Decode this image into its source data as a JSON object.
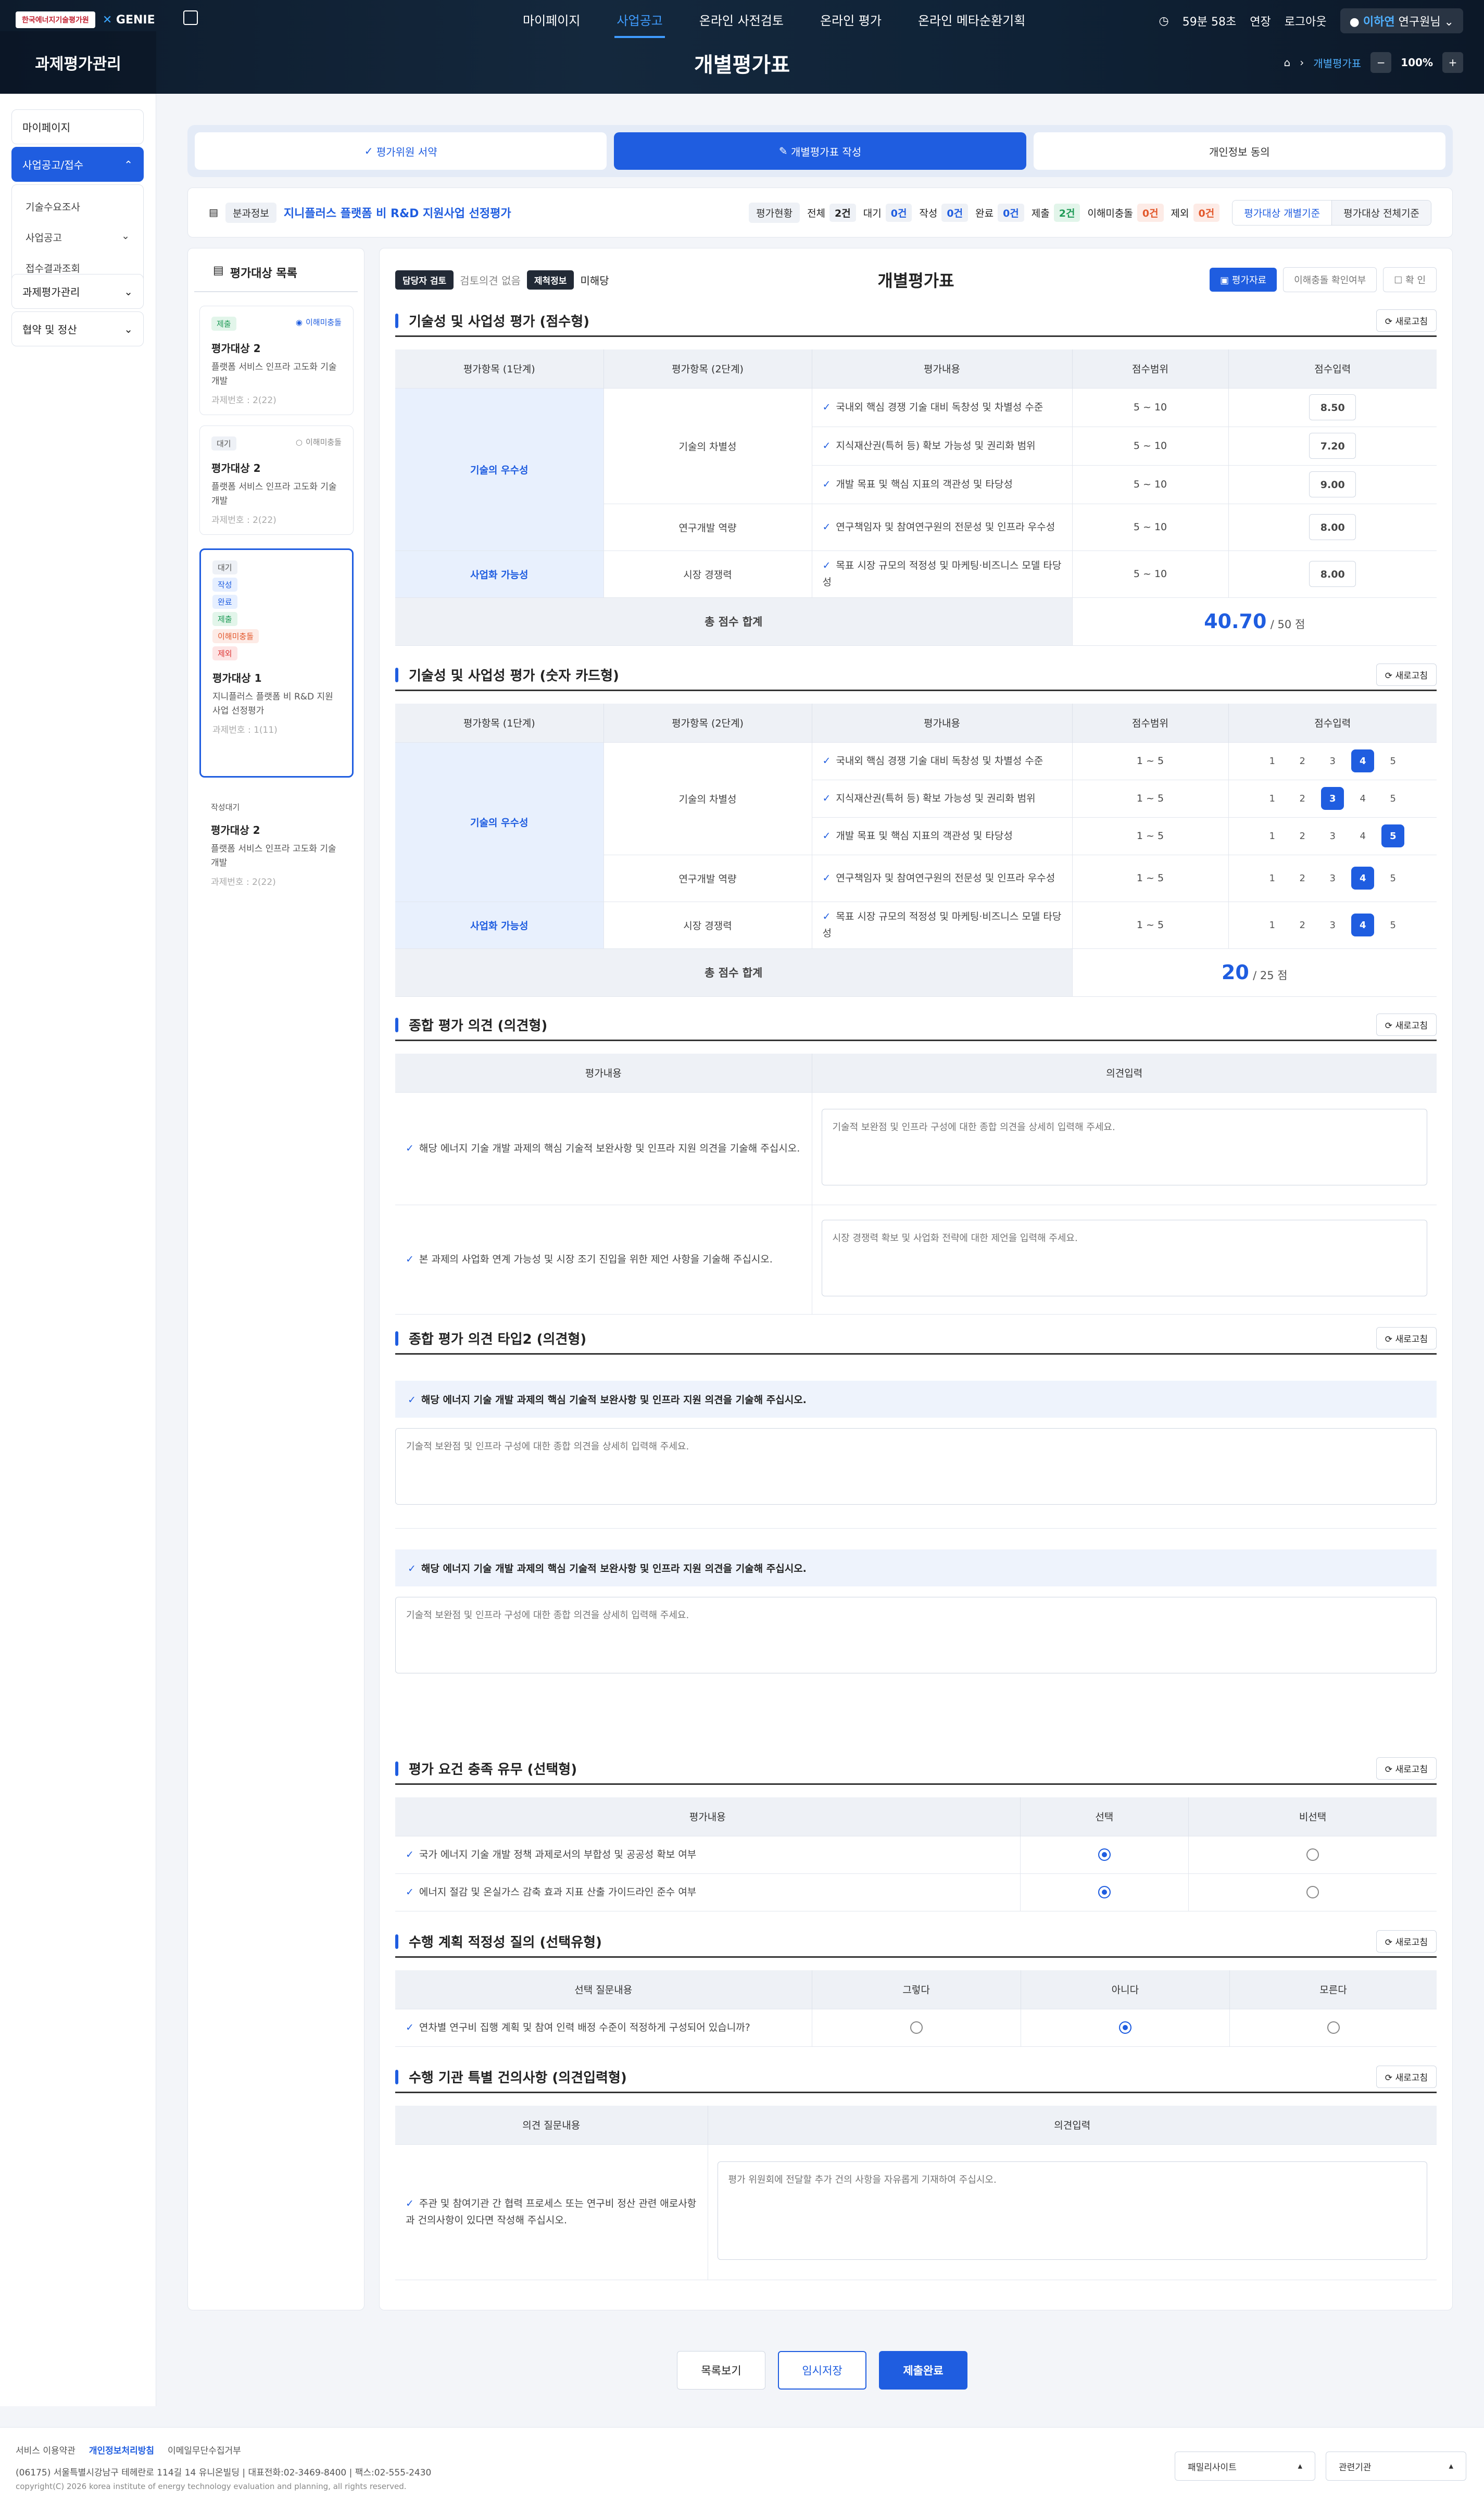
{
  "header": {
    "logo_left": "한국에너지기술평가원",
    "logo_right": "GENIE",
    "menu": [
      "마이페이지",
      "사업공고",
      "온라인 사전검토",
      "온라인 평가",
      "온라인 메타순환기획"
    ],
    "timer": "59분 58초",
    "extend": "연장",
    "logout": "로그아웃",
    "user_name": "이하연",
    "user_role": "연구원님",
    "section_title": "과제평가관리",
    "page_title": "개별평가표",
    "breadcrumb_current": "개별평가표",
    "zoom": "100%"
  },
  "sidebar": {
    "items": [
      "마이페이지",
      "사업공고/접수",
      "과제평가관리",
      "협약 및 정산"
    ],
    "sub_items": [
      "기술수요조사",
      "사업공고",
      "접수결과조회"
    ]
  },
  "steps": [
    "평가위원 서약",
    "개별평가표 작성",
    "개인정보 동의"
  ],
  "info": {
    "label": "분과정보",
    "project": "지니플러스 플랫폼 비 R&D 지원사업 선정평가",
    "status_label": "평가현황",
    "stats": [
      {
        "label": "전체",
        "value": "2건"
      },
      {
        "label": "대기",
        "value": "0건"
      },
      {
        "label": "작성",
        "value": "0건"
      },
      {
        "label": "완료",
        "value": "0건"
      },
      {
        "label": "제출",
        "value": "2건"
      },
      {
        "label": "이해미충돌",
        "value": "0건"
      },
      {
        "label": "제외",
        "value": "0건"
      }
    ],
    "toggle": [
      "평가대상 개별기준",
      "평가대상 전체기준"
    ]
  },
  "list": {
    "title": "평가대상 목록",
    "cards": [
      {
        "tags": [
          "제출"
        ],
        "obj": "이해미충돌",
        "title": "평가대상 2",
        "desc": "플랫폼 서비스 인프라 고도화 기술개발",
        "meta": "과제번호 : 2(22)"
      },
      {
        "tags": [
          "대기"
        ],
        "obj": "이해미충돌",
        "title": "평가대상 2",
        "desc": "플랫폼 서비스 인프라 고도화 기술개발",
        "meta": "과제번호 : 2(22)"
      },
      {
        "tags": [
          "대기",
          "작성",
          "완료",
          "제출",
          "이해미충돌",
          "제외"
        ],
        "title": "평가대상 1",
        "desc": "지니플러스 플랫폼 비 R&D 지원사업 선정평가",
        "meta": "과제번호 : 1(11)"
      },
      {
        "tags": [
          "작성대기"
        ],
        "title": "평가대상 2",
        "desc": "플랫폼 서비스 인프라 고도화 기술개발",
        "meta": "과제번호 : 2(22)"
      }
    ]
  },
  "form": {
    "head_tag1": "담당자 검토",
    "head_val1": "검토의견 없음",
    "head_tag2": "제척정보",
    "head_val2": "미해당",
    "title": "개별평가표",
    "btn_material": "평가자료",
    "btn_conflict": "이해충돌 확인여부",
    "btn_confirm": "확 인",
    "refresh": "새로고침",
    "col_headers": [
      "평가항목 (1단계)",
      "평가항목 (2단계)",
      "평가내용",
      "점수범위",
      "점수입력"
    ],
    "level1": [
      "기술의 우수성",
      "사업화 가능성"
    ],
    "level2": [
      "기술의 차별성",
      "연구개발 역량",
      "시장 경쟁력"
    ],
    "criteria": [
      "국내외 핵심 경쟁 기술 대비 독창성 및 차별성 수준",
      "지식재산권(특허 등) 확보 가능성 및 권리화 범위",
      "개발 목표 및 핵심 지표의 객관성 및 타당성",
      "연구책임자 및 참여연구원의 전문성 및 인프라 우수성",
      "목표 시장 규모의 적정성 및 마케팅·비즈니스 모델 타당성"
    ],
    "total_label": "총 점수 합계",
    "sections": [
      {
        "title": "기술성 및 사업성 평가 (점수형)",
        "range": "5 ~ 10",
        "scores": [
          "8.50",
          "7.20",
          "9.00",
          "8.00",
          "8.00"
        ],
        "total": "40.70",
        "max": "50",
        "unit": "점"
      },
      {
        "title": "기술성 및 사업성 평가 (숫자 카드형)",
        "range": "1 ~ 5",
        "options": [
          "1",
          "2",
          "3",
          "4",
          "5"
        ],
        "selected": [
          4,
          3,
          5,
          4,
          4
        ],
        "total": "20",
        "max": "25",
        "unit": "점"
      },
      {
        "title": "종합 평가 의견 (의견형)",
        "headers": [
          "평가내용",
          "의견입력"
        ],
        "rows": [
          {
            "q": "해당 에너지 기술 개발 과제의 핵심 기술적 보완사항 및 인프라 지원 의견을 기술해 주십시오.",
            "placeholder": "기술적 보완점 및 인프라 구성에 대한 종합 의견을 상세히 입력해 주세요."
          },
          {
            "q": "본 과제의 사업화 연계 가능성 및 시장 조기 진입을 위한 제언 사항을 기술해 주십시오.",
            "placeholder": "시장 경쟁력 확보 및 사업화 전략에 대한 제언을 입력해 주세요."
          }
        ]
      },
      {
        "title": "종합 평가 의견 타입2 (의견형)",
        "rows": [
          {
            "q": "해당 에너지 기술 개발 과제의 핵심 기술적 보완사항 및 인프라 지원 의견을 기술해 주십시오.",
            "placeholder": "기술적 보완점 및 인프라 구성에 대한 종합 의견을 상세히 입력해 주세요."
          },
          {
            "q": "해당 에너지 기술 개발 과제의 핵심 기술적 보완사항 및 인프라 지원 의견을 기술해 주십시오.",
            "placeholder": "기술적 보완점 및 인프라 구성에 대한 종합 의견을 상세히 입력해 주세요."
          }
        ]
      },
      {
        "title": "평가 요건 충족 유무 (선택형)",
        "headers": [
          "평가내용",
          "선택",
          "비선택"
        ],
        "rows": [
          {
            "q": "국가 에너지 기술 개발 정책 과제로서의 부합성 및 공공성 확보 여부",
            "selected": 0
          },
          {
            "q": "에너지 절감 및 온실가스 감축 효과 지표 산출 가이드라인 준수 여부",
            "selected": 0
          }
        ]
      },
      {
        "title": "수행 계획 적정성 질의 (선택유형)",
        "headers": [
          "선택 질문내용",
          "그렇다",
          "아니다",
          "모른다"
        ],
        "rows": [
          {
            "q": "연차별 연구비 집행 계획 및 참여 인력 배정 수준이 적정하게 구성되어 있습니까?",
            "selected": 1
          }
        ]
      },
      {
        "title": "수행 기관 특별 건의사항 (의견입력형)",
        "headers": [
          "의견 질문내용",
          "의견입력"
        ],
        "rows": [
          {
            "q": "주관 및 참여기관 간 협력 프로세스 또는 연구비 정산 관련 애로사항과 건의사항이 있다면 작성해 주십시오.",
            "placeholder": "평가 위원회에 전달할 추가 건의 사항을 자유롭게 기재하여 주십시오."
          }
        ]
      }
    ]
  },
  "actions": [
    "목록보기",
    "임시저장",
    "제출완료"
  ],
  "footer": {
    "links": [
      "서비스 이용약관",
      "개인정보처리방침",
      "이메일무단수집거부"
    ],
    "address": "(06175) 서울특별시강남구 테헤란로 114길 14 유니온빌딩  |  대표전화:02-3469-8400  |  팩스:02-555-2430",
    "copyright": "copyright(C) 2026 korea institute of energy technology evaluation and planning, all rights reserved.",
    "family_site": "패밀리사이트",
    "related": "관련기관"
  }
}
